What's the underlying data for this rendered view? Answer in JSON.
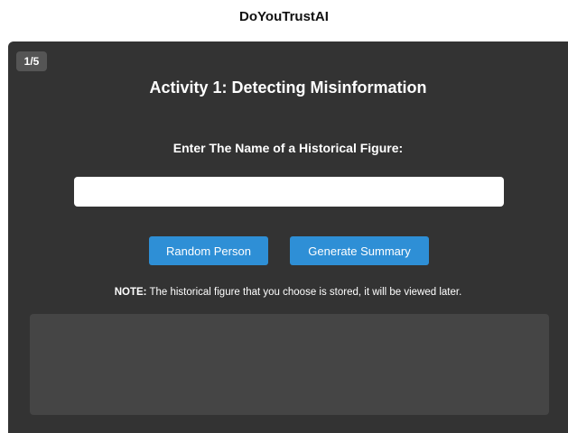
{
  "app": {
    "title": "DoYouTrustAI"
  },
  "panel": {
    "step_badge": "1/5",
    "activity_title": "Activity 1: Detecting Misinformation",
    "prompt_label": "Enter The Name of a Historical Figure:",
    "name_input": {
      "value": "",
      "placeholder": ""
    },
    "buttons": {
      "random_label": "Random Person",
      "generate_label": "Generate Summary"
    },
    "note": {
      "prefix": "NOTE:",
      "text": " The historical figure that you choose is stored, it will be viewed later."
    },
    "summary_text": ""
  },
  "colors": {
    "panel_bg": "#333333",
    "button_bg": "#2e8fd6",
    "summary_bg": "#454545",
    "badge_bg": "#555555"
  }
}
